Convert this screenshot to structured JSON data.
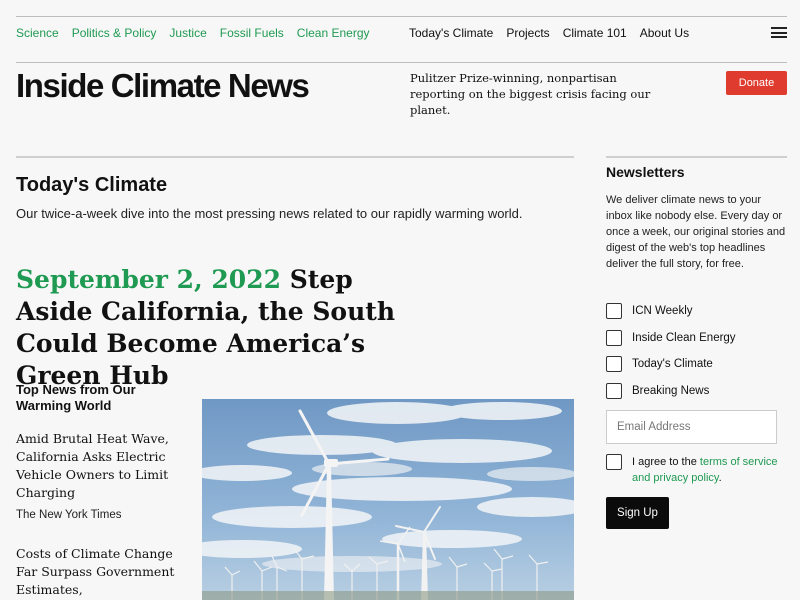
{
  "top_nav": {
    "categories": [
      {
        "label": "Science"
      },
      {
        "label": "Politics & Policy"
      },
      {
        "label": "Justice"
      },
      {
        "label": "Fossil Fuels"
      },
      {
        "label": "Clean Energy"
      }
    ],
    "site_links": [
      {
        "label": "Today's Climate"
      },
      {
        "label": "Projects"
      },
      {
        "label": "Climate 101"
      },
      {
        "label": "About Us"
      }
    ],
    "menu_icon": "hamburger-menu-icon"
  },
  "masthead": {
    "logo": "Inside Climate News",
    "tagline": "Pulitzer Prize-winning, nonpartisan reporting on the biggest crisis facing our planet.",
    "donate_label": "Donate"
  },
  "main": {
    "section_title": "Today's Climate",
    "section_description": "Our twice-a-week dive into the most pressing news related to our rapidly warming world.",
    "headline_date": "September 2, 2022",
    "headline_title": "Step Aside California, the South Could Become America’s Green Hub",
    "top_news_heading": "Top News from Our Warming World",
    "stories": [
      {
        "title": "Amid Brutal Heat Wave, California Asks Electric Vehicle Owners to Limit Charging",
        "source": "The New York Times"
      },
      {
        "title": "Costs of Climate Change Far Surpass Government Estimates,",
        "source": ""
      }
    ]
  },
  "sidebar": {
    "title": "Newsletters",
    "description": "We deliver climate news to your inbox like nobody else. Every day or once a week, our original stories and digest of the web's top headlines deliver the full story, for free.",
    "options": [
      {
        "label": "ICN Weekly",
        "checked": false
      },
      {
        "label": "Inside Clean Energy",
        "checked": false
      },
      {
        "label": "Today's Climate",
        "checked": false
      },
      {
        "label": "Breaking News",
        "checked": false
      }
    ],
    "email_placeholder": "Email Address",
    "agree_prefix": "I agree to the ",
    "agree_link": "terms of service and privacy policy",
    "agree_suffix": ".",
    "signup_label": "Sign Up"
  },
  "colors": {
    "accent_green": "#1f9a52",
    "donate_red": "#df3b2e",
    "button_black": "#0b0b0b",
    "background": "#f7f7f7"
  }
}
